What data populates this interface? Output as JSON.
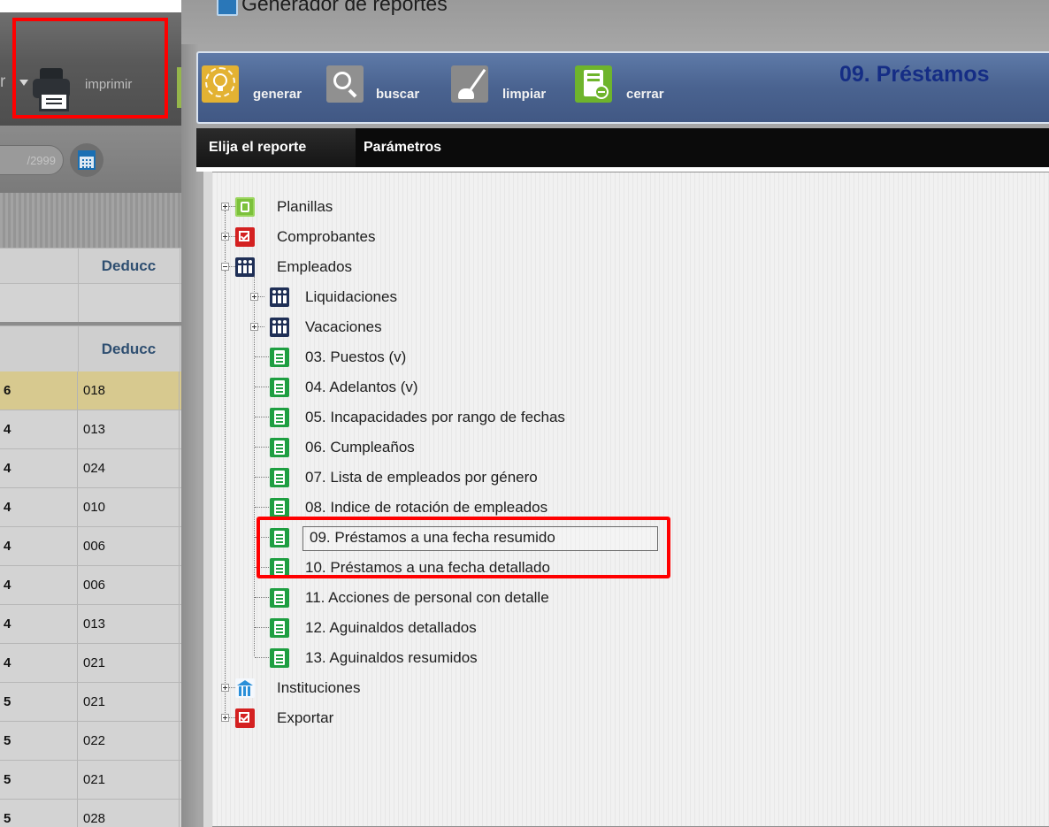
{
  "background_app": {
    "toolbar": {
      "prev_arrow": "r",
      "print_label": "imprimir"
    },
    "date_field": {
      "value": "/2999"
    },
    "grid": {
      "header_label": "Deducc",
      "header_label_2": "Deducc",
      "rows": [
        {
          "a": "6",
          "b": "018"
        },
        {
          "a": "4",
          "b": "013"
        },
        {
          "a": "4",
          "b": "024"
        },
        {
          "a": "4",
          "b": "010"
        },
        {
          "a": "4",
          "b": "006"
        },
        {
          "a": "4",
          "b": "006"
        },
        {
          "a": "4",
          "b": "013"
        },
        {
          "a": "4",
          "b": "021"
        },
        {
          "a": "5",
          "b": "021"
        },
        {
          "a": "5",
          "b": "022"
        },
        {
          "a": "5",
          "b": "021"
        },
        {
          "a": "5",
          "b": "028"
        }
      ]
    }
  },
  "dialog": {
    "title": "Generador de reportes",
    "report_title": "09. Préstamos",
    "toolbar": {
      "generar": "generar",
      "buscar": "buscar",
      "limpiar": "limpiar",
      "cerrar": "cerrar"
    },
    "tabs": {
      "choose": "Elija el reporte",
      "params": "Parámetros"
    },
    "tree": {
      "planillas": "Planillas",
      "comprobantes": "Comprobantes",
      "empleados": "Empleados",
      "liquidaciones": "Liquidaciones",
      "vacaciones": "Vacaciones",
      "r03": "03. Puestos (v)",
      "r04": "04. Adelantos (v)",
      "r05": "05. Incapacidades por rango de fechas",
      "r06": "06. Cumpleaños",
      "r07": "07. Lista de empleados por género",
      "r08": "08. Indice de rotación de empleados",
      "r09": "09. Préstamos a una fecha resumido",
      "r10": "10. Préstamos a una fecha detallado",
      "r11": "11. Acciones de personal con detalle",
      "r12": "12. Aguinaldos detallados",
      "r13": "13. Aguinaldos resumidos",
      "instituciones": "Instituciones",
      "exportar": "Exportar"
    }
  },
  "colors": {
    "highlight": "#ff0000",
    "toolbar_blue": "#4a6390",
    "report_title": "#152d85",
    "selected_row": "#d7c98f"
  }
}
